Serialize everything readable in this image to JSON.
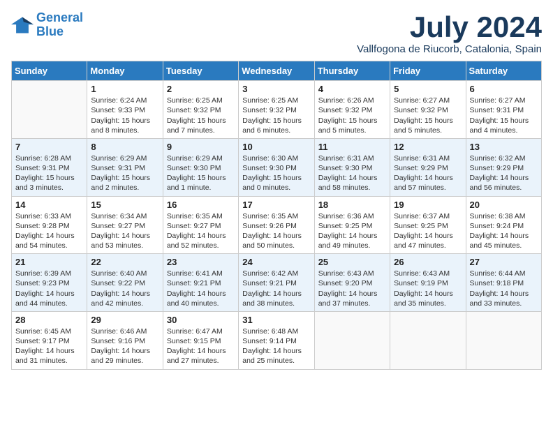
{
  "logo": {
    "line1": "General",
    "line2": "Blue"
  },
  "title": "July 2024",
  "subtitle": "Vallfogona de Riucorb, Catalonia, Spain",
  "weekdays": [
    "Sunday",
    "Monday",
    "Tuesday",
    "Wednesday",
    "Thursday",
    "Friday",
    "Saturday"
  ],
  "weeks": [
    [
      {
        "day": "",
        "info": ""
      },
      {
        "day": "1",
        "info": "Sunrise: 6:24 AM\nSunset: 9:33 PM\nDaylight: 15 hours\nand 8 minutes."
      },
      {
        "day": "2",
        "info": "Sunrise: 6:25 AM\nSunset: 9:32 PM\nDaylight: 15 hours\nand 7 minutes."
      },
      {
        "day": "3",
        "info": "Sunrise: 6:25 AM\nSunset: 9:32 PM\nDaylight: 15 hours\nand 6 minutes."
      },
      {
        "day": "4",
        "info": "Sunrise: 6:26 AM\nSunset: 9:32 PM\nDaylight: 15 hours\nand 5 minutes."
      },
      {
        "day": "5",
        "info": "Sunrise: 6:27 AM\nSunset: 9:32 PM\nDaylight: 15 hours\nand 5 minutes."
      },
      {
        "day": "6",
        "info": "Sunrise: 6:27 AM\nSunset: 9:31 PM\nDaylight: 15 hours\nand 4 minutes."
      }
    ],
    [
      {
        "day": "7",
        "info": "Sunrise: 6:28 AM\nSunset: 9:31 PM\nDaylight: 15 hours\nand 3 minutes."
      },
      {
        "day": "8",
        "info": "Sunrise: 6:29 AM\nSunset: 9:31 PM\nDaylight: 15 hours\nand 2 minutes."
      },
      {
        "day": "9",
        "info": "Sunrise: 6:29 AM\nSunset: 9:30 PM\nDaylight: 15 hours\nand 1 minute."
      },
      {
        "day": "10",
        "info": "Sunrise: 6:30 AM\nSunset: 9:30 PM\nDaylight: 15 hours\nand 0 minutes."
      },
      {
        "day": "11",
        "info": "Sunrise: 6:31 AM\nSunset: 9:30 PM\nDaylight: 14 hours\nand 58 minutes."
      },
      {
        "day": "12",
        "info": "Sunrise: 6:31 AM\nSunset: 9:29 PM\nDaylight: 14 hours\nand 57 minutes."
      },
      {
        "day": "13",
        "info": "Sunrise: 6:32 AM\nSunset: 9:29 PM\nDaylight: 14 hours\nand 56 minutes."
      }
    ],
    [
      {
        "day": "14",
        "info": "Sunrise: 6:33 AM\nSunset: 9:28 PM\nDaylight: 14 hours\nand 54 minutes."
      },
      {
        "day": "15",
        "info": "Sunrise: 6:34 AM\nSunset: 9:27 PM\nDaylight: 14 hours\nand 53 minutes."
      },
      {
        "day": "16",
        "info": "Sunrise: 6:35 AM\nSunset: 9:27 PM\nDaylight: 14 hours\nand 52 minutes."
      },
      {
        "day": "17",
        "info": "Sunrise: 6:35 AM\nSunset: 9:26 PM\nDaylight: 14 hours\nand 50 minutes."
      },
      {
        "day": "18",
        "info": "Sunrise: 6:36 AM\nSunset: 9:25 PM\nDaylight: 14 hours\nand 49 minutes."
      },
      {
        "day": "19",
        "info": "Sunrise: 6:37 AM\nSunset: 9:25 PM\nDaylight: 14 hours\nand 47 minutes."
      },
      {
        "day": "20",
        "info": "Sunrise: 6:38 AM\nSunset: 9:24 PM\nDaylight: 14 hours\nand 45 minutes."
      }
    ],
    [
      {
        "day": "21",
        "info": "Sunrise: 6:39 AM\nSunset: 9:23 PM\nDaylight: 14 hours\nand 44 minutes."
      },
      {
        "day": "22",
        "info": "Sunrise: 6:40 AM\nSunset: 9:22 PM\nDaylight: 14 hours\nand 42 minutes."
      },
      {
        "day": "23",
        "info": "Sunrise: 6:41 AM\nSunset: 9:21 PM\nDaylight: 14 hours\nand 40 minutes."
      },
      {
        "day": "24",
        "info": "Sunrise: 6:42 AM\nSunset: 9:21 PM\nDaylight: 14 hours\nand 38 minutes."
      },
      {
        "day": "25",
        "info": "Sunrise: 6:43 AM\nSunset: 9:20 PM\nDaylight: 14 hours\nand 37 minutes."
      },
      {
        "day": "26",
        "info": "Sunrise: 6:43 AM\nSunset: 9:19 PM\nDaylight: 14 hours\nand 35 minutes."
      },
      {
        "day": "27",
        "info": "Sunrise: 6:44 AM\nSunset: 9:18 PM\nDaylight: 14 hours\nand 33 minutes."
      }
    ],
    [
      {
        "day": "28",
        "info": "Sunrise: 6:45 AM\nSunset: 9:17 PM\nDaylight: 14 hours\nand 31 minutes."
      },
      {
        "day": "29",
        "info": "Sunrise: 6:46 AM\nSunset: 9:16 PM\nDaylight: 14 hours\nand 29 minutes."
      },
      {
        "day": "30",
        "info": "Sunrise: 6:47 AM\nSunset: 9:15 PM\nDaylight: 14 hours\nand 27 minutes."
      },
      {
        "day": "31",
        "info": "Sunrise: 6:48 AM\nSunset: 9:14 PM\nDaylight: 14 hours\nand 25 minutes."
      },
      {
        "day": "",
        "info": ""
      },
      {
        "day": "",
        "info": ""
      },
      {
        "day": "",
        "info": ""
      }
    ]
  ]
}
